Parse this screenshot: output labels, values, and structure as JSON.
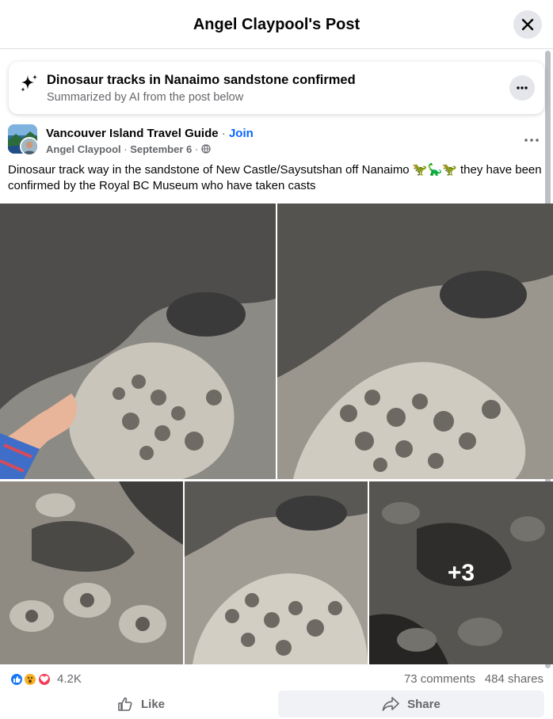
{
  "dialog": {
    "title": "Angel Claypool's Post",
    "close_icon": "close-icon"
  },
  "ai_summary": {
    "title": "Dinosaur tracks in Nanaimo sandstone confirmed",
    "subtitle": "Summarized by AI from the post below",
    "icon": "sparkle-icon",
    "more_icon": "more-horizontal-icon"
  },
  "post": {
    "group_name": "Vancouver Island Travel Guide",
    "separator": "·",
    "join_label": "Join",
    "author": "Angel Claypool",
    "date": "September 6",
    "privacy_icon": "globe-icon",
    "text": "Dinosaur track way in the sandstone of New Castle/Saysutshan off Nanaimo 🦖🦕🦖 they have been confirmed by the Royal BC Museum who have taken casts",
    "photos": [
      {
        "description": "dinosaur-track-with-hand"
      },
      {
        "description": "dinosaur-track-closeup"
      },
      {
        "description": "sandstone-tracks-1"
      },
      {
        "description": "sandstone-tracks-2"
      },
      {
        "description": "sandstone-tracks-3"
      }
    ],
    "more_photos_label": "+3"
  },
  "stats": {
    "reactions_count": "4.2K",
    "reaction_icons": [
      "like-icon",
      "wow-icon",
      "love-icon"
    ],
    "comments": "73 comments",
    "shares": "484 shares"
  },
  "actions": {
    "like_label": "Like",
    "share_label": "Share"
  },
  "colors": {
    "accent": "#0866ff",
    "secondary_text": "#65676b",
    "like": "#1877f2",
    "wow": "#f7b125",
    "love": "#f33e58"
  }
}
